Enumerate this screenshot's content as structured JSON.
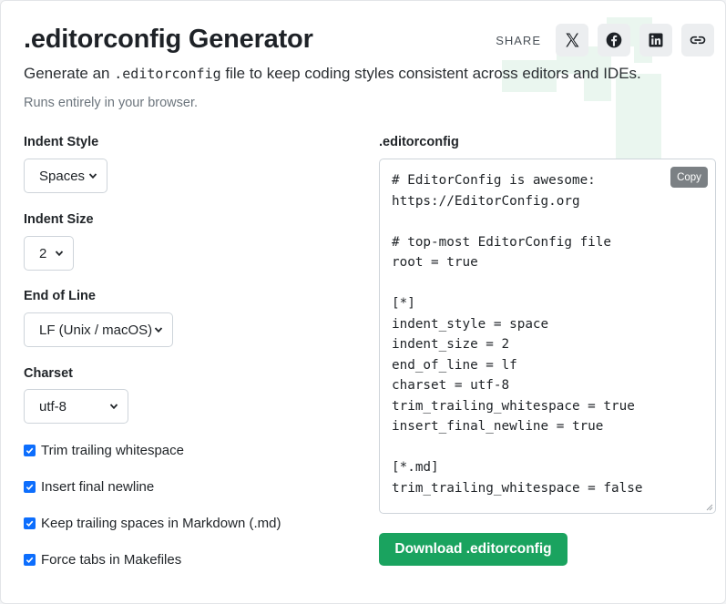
{
  "header": {
    "title": ".editorconfig Generator",
    "share_label": "SHARE",
    "share_buttons": [
      {
        "icon": "x-icon",
        "name": "X"
      },
      {
        "icon": "facebook-icon",
        "name": "Facebook"
      },
      {
        "icon": "linkedin-icon",
        "name": "LinkedIn"
      },
      {
        "icon": "link-icon",
        "name": "Copy link"
      }
    ]
  },
  "intro": {
    "text_before": "Generate an ",
    "code": ".editorconfig",
    "text_after": " file to keep coding styles consistent across editors and IDEs.",
    "note": "Runs entirely in your browser."
  },
  "form": {
    "indent_style": {
      "label": "Indent Style",
      "value": "Spaces"
    },
    "indent_size": {
      "label": "Indent Size",
      "value": "2"
    },
    "end_of_line": {
      "label": "End of Line",
      "value": "LF (Unix / macOS)"
    },
    "charset": {
      "label": "Charset",
      "value": "utf-8"
    },
    "checkboxes": [
      {
        "label": "Trim trailing whitespace",
        "checked": true
      },
      {
        "label": "Insert final newline",
        "checked": true
      },
      {
        "label": "Keep trailing spaces in Markdown (.md)",
        "checked": true
      },
      {
        "label": "Force tabs in Makefiles",
        "checked": true
      }
    ]
  },
  "output": {
    "label": ".editorconfig",
    "copy_label": "Copy",
    "content": "# EditorConfig is awesome:\nhttps://EditorConfig.org\n\n# top-most EditorConfig file\nroot = true\n\n[*]\nindent_style = space\nindent_size = 2\nend_of_line = lf\ncharset = utf-8\ntrim_trailing_whitespace = true\ninsert_final_newline = true\n\n[*.md]\ntrim_trailing_whitespace = false",
    "download_label": "Download .editorconfig"
  },
  "colors": {
    "accent_green": "#1aa35f",
    "checkbox_blue": "#0d6efd",
    "copy_button": "#7b8084",
    "watermark": "#e9f6ee"
  }
}
